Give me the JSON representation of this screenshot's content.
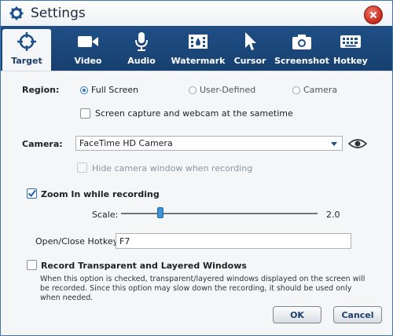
{
  "window": {
    "title": "Settings"
  },
  "tabs": [
    {
      "label": "Target",
      "icon": "target-icon",
      "active": true
    },
    {
      "label": "Video",
      "icon": "video-camera-icon"
    },
    {
      "label": "Audio",
      "icon": "microphone-icon"
    },
    {
      "label": "Watermark",
      "icon": "watermark-icon"
    },
    {
      "label": "Cursor",
      "icon": "cursor-icon"
    },
    {
      "label": "Screenshot",
      "icon": "camera-icon"
    },
    {
      "label": "Hotkey",
      "icon": "keyboard-icon"
    }
  ],
  "region": {
    "label": "Region:",
    "options": [
      "Full Screen",
      "User-Defined",
      "Camera"
    ],
    "selected": "Full Screen",
    "simultaneous_label": "Screen capture and webcam at the sametime"
  },
  "camera": {
    "label": "Camera:",
    "selected": "FaceTime HD Camera",
    "hide_label": "Hide camera window when recording"
  },
  "zoom": {
    "label": "Zoom In while recording",
    "checked": true,
    "scale_label": "Scale:",
    "scale_value": "2.0",
    "scale_fraction": 0.2,
    "hotkey_label": "Open/Close Hotkey:",
    "hotkey_value": "F7"
  },
  "transparent": {
    "label": "Record Transparent and Layered Windows",
    "checked": false,
    "description": "When this option is checked, transparent/layered windows displayed on the screen will be recorded. Since this option may slow down the recording, it should be used only when needed."
  },
  "buttons": {
    "ok": "OK",
    "cancel": "Cancel"
  },
  "colors": {
    "toolbar": "#1f4f86",
    "accent": "#2b79c8",
    "close": "#c2261a"
  }
}
